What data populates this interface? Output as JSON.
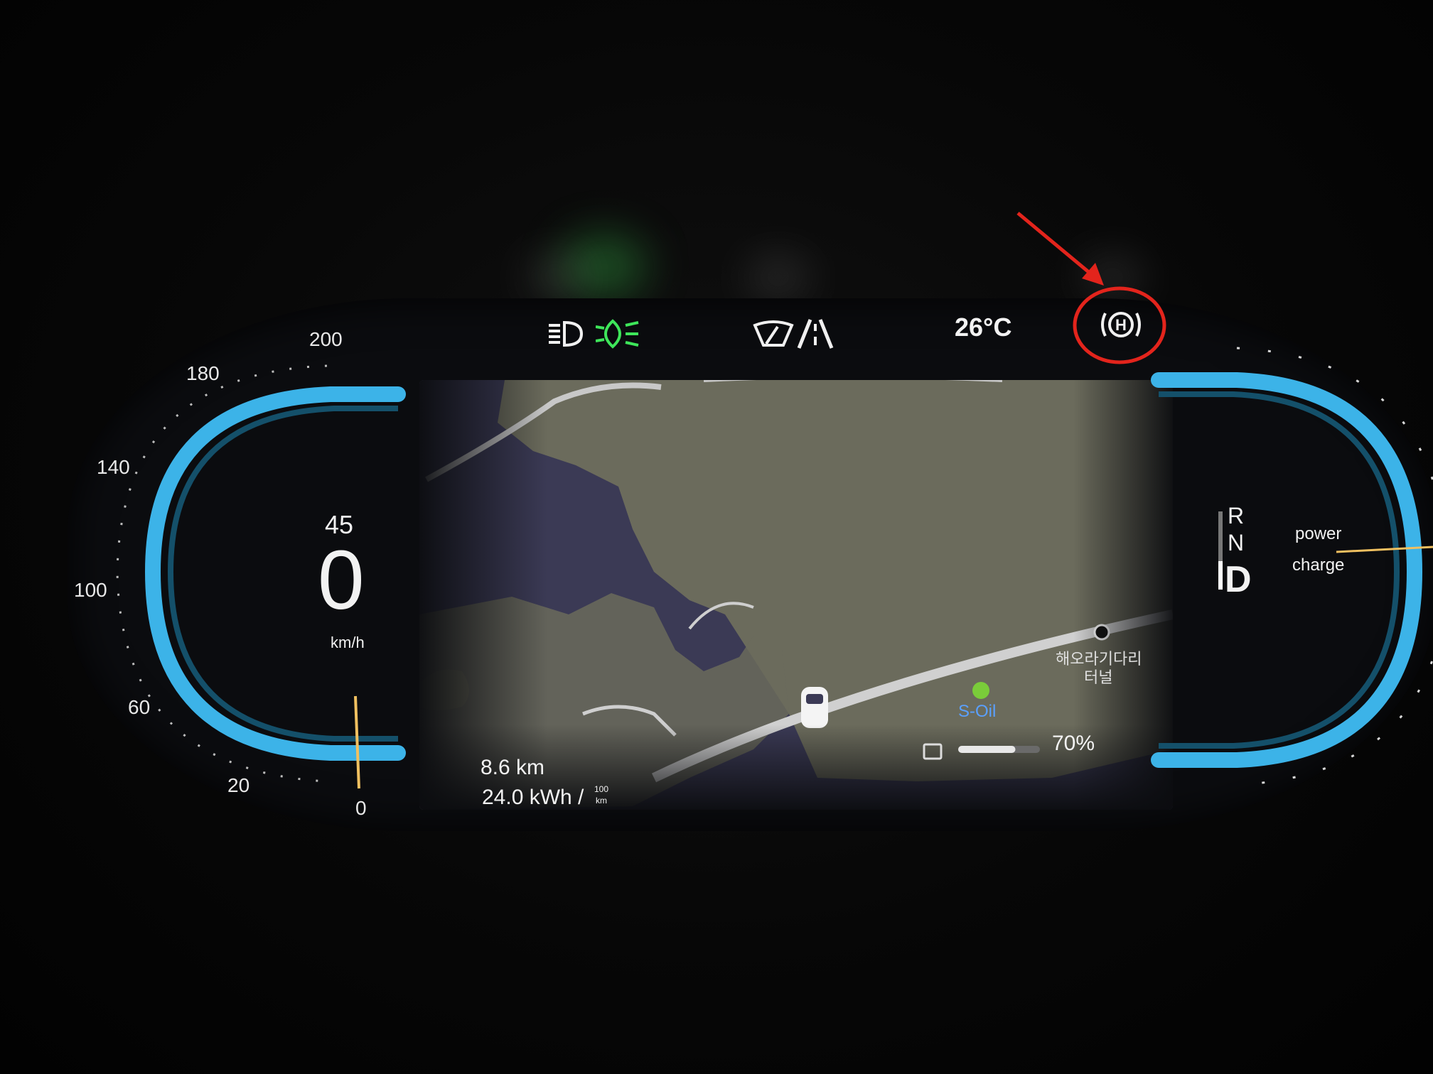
{
  "top_bar": {
    "temperature": "26°C",
    "icons": [
      "headlight-icon",
      "green-light-icon",
      "wiper-icon",
      "lane-icon",
      "auto-hold-icon"
    ],
    "icon_colors": {
      "green": "#3ee65a",
      "white": "#f0f0f0"
    }
  },
  "speedometer": {
    "ticks": [
      "200",
      "180",
      "140",
      "100",
      "60",
      "20",
      "0"
    ],
    "speed_limit": "45",
    "speed": "0",
    "unit": "km/h",
    "ring_color": "#39b4ea"
  },
  "gear": {
    "positions": [
      "R",
      "N",
      "D"
    ],
    "selected": "D"
  },
  "power_meter": {
    "power_label": "power",
    "charge_label": "charge"
  },
  "trip": {
    "distance": "8.6 km",
    "consumption": "24.0 kWh /",
    "consumption_unit_top": "100",
    "consumption_unit_bottom": "km"
  },
  "battery": {
    "percent": "70%",
    "level": 0.7
  },
  "map": {
    "tunnel_name_line1": "해오라기다리",
    "tunnel_name_line2": "터널",
    "station_name": "S-Oil",
    "colors": {
      "water": "#3b3a55",
      "land": "#6d6d5f",
      "road": "#c8c8c8"
    }
  },
  "annotation": {
    "color": "#e3241c"
  }
}
